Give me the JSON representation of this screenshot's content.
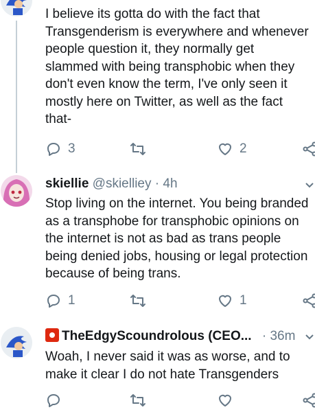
{
  "tweets": [
    {
      "text": "I believe its gotta do with the fact that\nTransgenderism is everywhere and whenever\npeople question it, they normally get\nslammed with being transphobic when they\ndon't even know the term, I've only seen it\nmostly here on Twitter, as well as the fact\nthat-",
      "replies": "3",
      "likes": "2"
    },
    {
      "name": "skiellie",
      "handle": "@skielliey",
      "time": "4h",
      "text": "Stop living on the internet. You being branded\nas a transphobe for transphobic opinions on\nthe internet is not as bad as trans people\nbeing denied jobs, housing or legal protection\nbecause of being trans.",
      "replies": "1",
      "likes": "1"
    },
    {
      "name": "TheEdgyScoundrolous (CEO...",
      "time": "36m",
      "text": "Woah, I never said it was as worse, and to\nmake it clear I do not hate Transgenders",
      "replies": "",
      "likes": ""
    }
  ],
  "separator": "·",
  "icons": [
    "reply-icon",
    "retweet-icon",
    "like-icon",
    "share-icon",
    "chevron-down-icon"
  ],
  "colors": {
    "text": "#14171a",
    "muted": "#657786",
    "thread": "#c4cfd6",
    "flag": "#de2910"
  }
}
